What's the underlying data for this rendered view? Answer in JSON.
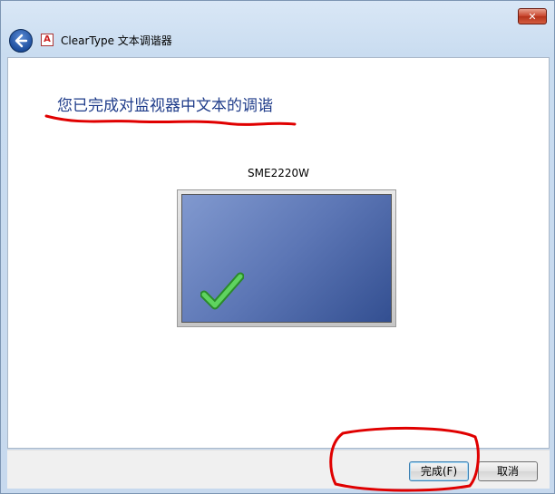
{
  "window": {
    "title": "ClearType 文本调谐器",
    "close_label": "✕",
    "app_icon_letter": "A"
  },
  "page": {
    "heading": "您已完成对监视器中文本的调谐",
    "monitor_name": "SME2220W"
  },
  "footer": {
    "finish_label": "完成(F)",
    "cancel_label": "取消"
  },
  "colors": {
    "heading": "#1f3c8a",
    "annotation": "#e00000",
    "screen_gradient_start": "#8199cf",
    "screen_gradient_end": "#334f91",
    "check": "#3db83d"
  }
}
